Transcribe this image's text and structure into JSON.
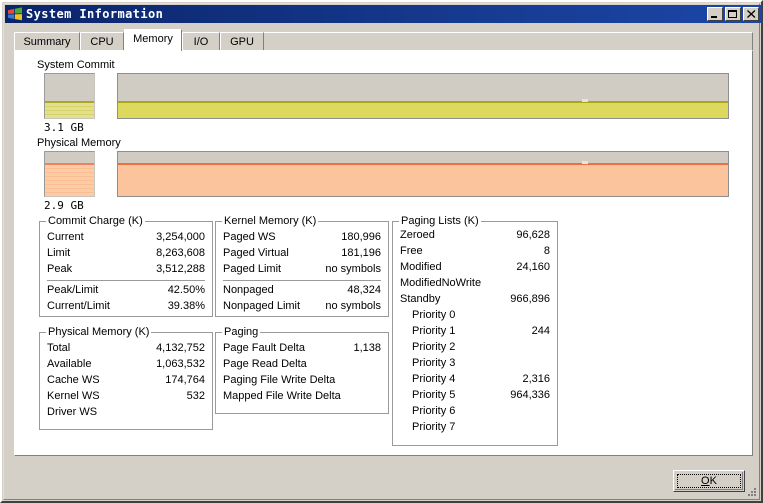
{
  "window": {
    "title": "System Information",
    "icon": "windows-flag-icon",
    "caption_buttons": [
      {
        "name": "minimize",
        "glyph": "_"
      },
      {
        "name": "maximize",
        "glyph": "□"
      },
      {
        "name": "close",
        "glyph": "✕"
      }
    ]
  },
  "tabs": [
    {
      "label": "Summary",
      "selected": false
    },
    {
      "label": "CPU",
      "selected": false
    },
    {
      "label": "Memory",
      "selected": true
    },
    {
      "label": "I/O",
      "selected": false
    },
    {
      "label": "GPU",
      "selected": false
    }
  ],
  "graphs": {
    "system_commit": {
      "label": "System Commit",
      "gauge_caption": "3.1 GB",
      "fill_percent": 39.38,
      "fill_color": "#d7d45c",
      "cap_color": "#9a9a20",
      "track_color": "#d0ccc4"
    },
    "physical_memory": {
      "label": "Physical Memory",
      "gauge_caption": "2.9 GB",
      "fill_percent": 74.3,
      "fill_color": "#fcc49c",
      "cap_color": "#e8693c",
      "track_color": "#d0ccc4"
    }
  },
  "commit_charge": {
    "title": "Commit Charge (K)",
    "rows": [
      {
        "label": "Current",
        "value": "3,254,000"
      },
      {
        "label": "Limit",
        "value": "8,263,608"
      },
      {
        "label": "Peak",
        "value": "3,512,288"
      }
    ],
    "rows2": [
      {
        "label": "Peak/Limit",
        "value": "42.50%"
      },
      {
        "label": "Current/Limit",
        "value": "39.38%"
      }
    ]
  },
  "physical_memory_panel": {
    "title": "Physical Memory (K)",
    "rows": [
      {
        "label": "Total",
        "value": "4,132,752"
      },
      {
        "label": "Available",
        "value": "1,063,532"
      },
      {
        "label": "Cache WS",
        "value": "174,764"
      },
      {
        "label": "Kernel WS",
        "value": "532"
      },
      {
        "label": "Driver WS",
        "value": ""
      }
    ]
  },
  "kernel_memory": {
    "title": "Kernel Memory (K)",
    "rows": [
      {
        "label": "Paged WS",
        "value": "180,996"
      },
      {
        "label": "Paged Virtual",
        "value": "181,196"
      },
      {
        "label": "Paged Limit",
        "value": "no symbols"
      }
    ],
    "rows2": [
      {
        "label": "Nonpaged",
        "value": "48,324"
      },
      {
        "label": "Nonpaged Limit",
        "value": "no symbols"
      }
    ]
  },
  "paging": {
    "title": "Paging",
    "rows": [
      {
        "label": "Page Fault Delta",
        "value": "1,138"
      },
      {
        "label": "Page Read Delta",
        "value": ""
      },
      {
        "label": "Paging File Write Delta",
        "value": ""
      },
      {
        "label": "Mapped File Write Delta",
        "value": ""
      }
    ]
  },
  "paging_lists": {
    "title": "Paging Lists (K)",
    "rows": [
      {
        "label": "Zeroed",
        "value": "96,628",
        "indent": false
      },
      {
        "label": "Free",
        "value": "8",
        "indent": false
      },
      {
        "label": "Modified",
        "value": "24,160",
        "indent": false
      },
      {
        "label": "ModifiedNoWrite",
        "value": "",
        "indent": false
      },
      {
        "label": "Standby",
        "value": "966,896",
        "indent": false
      },
      {
        "label": "Priority 0",
        "value": "",
        "indent": true
      },
      {
        "label": "Priority 1",
        "value": "244",
        "indent": true
      },
      {
        "label": "Priority 2",
        "value": "",
        "indent": true
      },
      {
        "label": "Priority 3",
        "value": "",
        "indent": true
      },
      {
        "label": "Priority 4",
        "value": "2,316",
        "indent": true
      },
      {
        "label": "Priority 5",
        "value": "964,336",
        "indent": true
      },
      {
        "label": "Priority 6",
        "value": "",
        "indent": true
      },
      {
        "label": "Priority 7",
        "value": "",
        "indent": true
      }
    ]
  },
  "footer": {
    "ok_label": "OK",
    "ok_mnemonic": "O"
  }
}
